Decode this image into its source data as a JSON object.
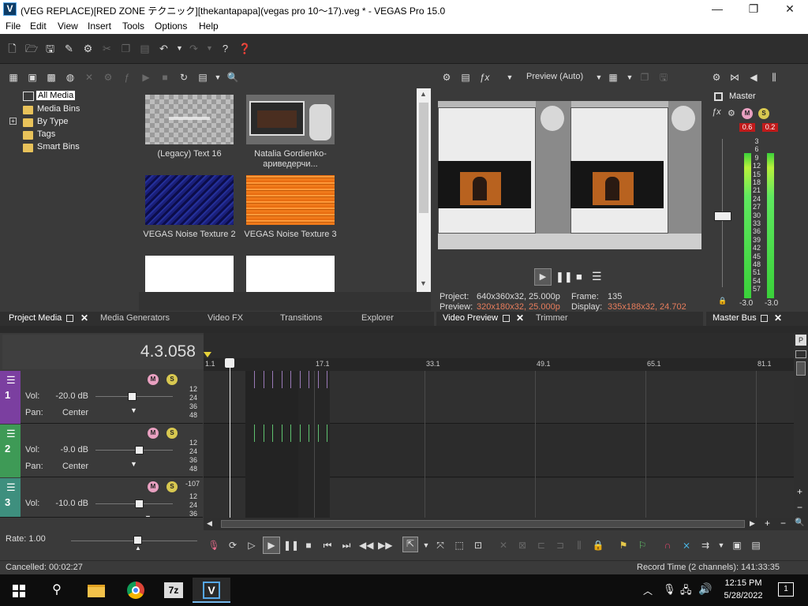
{
  "titlebar": {
    "app_icon": "V",
    "title": "(VEG REPLACE)[RED ZONE テクニック][thekantapapa](vegas pro 10〜17).veg * - VEGAS Pro 15.0",
    "minimize": "—",
    "maximize": "❐",
    "close": "✕"
  },
  "menu": [
    "File",
    "Edit",
    "View",
    "Insert",
    "Tools",
    "Options",
    "Help"
  ],
  "project_media": {
    "tree": [
      "All Media",
      "Media Bins",
      "By Type",
      "Tags",
      "Smart Bins"
    ],
    "media": [
      {
        "caption": "(Legacy) Text 16"
      },
      {
        "caption": "Natalia Gordienko-ариведерчи..."
      },
      {
        "caption": "VEGAS Noise Texture 2"
      },
      {
        "caption": "VEGAS Noise Texture 3"
      }
    ],
    "tabs": [
      "Project Media",
      "Media Generators",
      "Video FX",
      "Transitions",
      "Explorer"
    ]
  },
  "preview": {
    "mode": "Preview (Auto)",
    "project_label": "Project:",
    "project_value": "640x360x32, 25.000p",
    "preview_label": "Preview:",
    "preview_value": "320x180x32, 25.000p",
    "frame_label": "Frame:",
    "frame_value": "135",
    "display_label": "Display:",
    "display_value": "335x188x32, 24.702",
    "tabs": [
      "Video Preview",
      "Trimmer"
    ],
    "accent_color": "#e87d5c"
  },
  "master": {
    "label": "Master",
    "peak_left": "0.6",
    "peak_right": "0.2",
    "db_scale": [
      "3",
      "6",
      "9",
      "12",
      "15",
      "18",
      "21",
      "24",
      "27",
      "30",
      "33",
      "36",
      "39",
      "42",
      "45",
      "48",
      "51",
      "54",
      "57"
    ],
    "bottom_left": "-3.0",
    "bottom_right": "-3.0",
    "tab": "Master Bus"
  },
  "timeline": {
    "timecode": "4.3.058",
    "ruler": [
      "1.1",
      "17.1",
      "33.1",
      "49.1",
      "65.1",
      "81.1"
    ],
    "tracks": [
      {
        "num": "1",
        "vol_label": "Vol:",
        "vol": "-20.0 dB",
        "pan_label": "Pan:",
        "pan": "Center",
        "color": "#7b3fa0",
        "level": 0.45,
        "meter": [
          "12",
          "24",
          "36",
          "48"
        ]
      },
      {
        "num": "2",
        "vol_label": "Vol:",
        "vol": "-9.0 dB",
        "pan_label": "Pan:",
        "pan": "Center",
        "color": "#3e9a56",
        "level": 0.55,
        "meter": [
          "12",
          "24",
          "36",
          "48"
        ]
      },
      {
        "num": "3",
        "vol_label": "Vol:",
        "vol": "-10.0 dB",
        "color": "#3e8f7e",
        "level": 0.55,
        "meter_top": "-107",
        "meter": [
          "12",
          "24",
          "36"
        ]
      }
    ],
    "rate_label": "Rate: 1.00"
  },
  "status": {
    "left": "Cancelled: 00:02:27",
    "right": "Record Time (2 channels): 141:33:35"
  },
  "taskbar": {
    "time": "12:15 PM",
    "date": "5/28/2022",
    "notifications": "1",
    "sevenzip": "7z",
    "vegas": "V"
  }
}
